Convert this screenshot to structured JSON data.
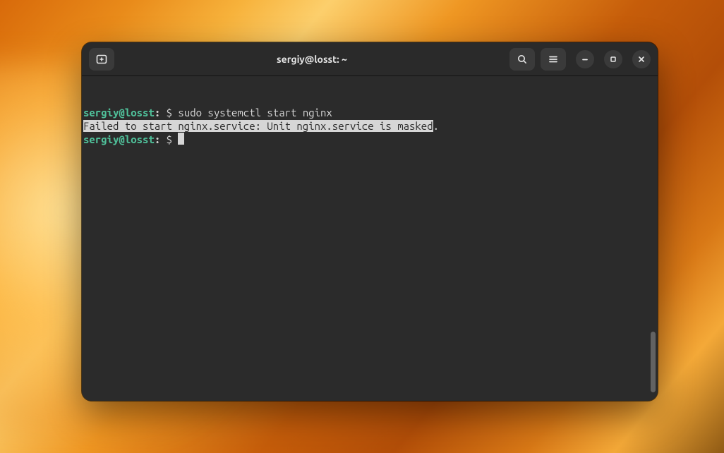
{
  "titlebar": {
    "title": "sergiy@losst: ~"
  },
  "terminal": {
    "lines": [
      {
        "user": "sergiy@losst",
        "sep": ":",
        "prompt": " $ ",
        "command": "sudo systemctl start nginx"
      },
      {
        "selected_output": "Failed to start nginx.service: Unit nginx.service is masked",
        "tail": "."
      },
      {
        "user": "sergiy@losst",
        "sep": ":",
        "prompt": " $ "
      }
    ]
  },
  "icons": {
    "new_tab": "new-tab-icon",
    "search": "search-icon",
    "menu": "hamburger-icon",
    "minimize": "minimize-icon",
    "maximize": "maximize-icon",
    "close": "close-icon"
  }
}
